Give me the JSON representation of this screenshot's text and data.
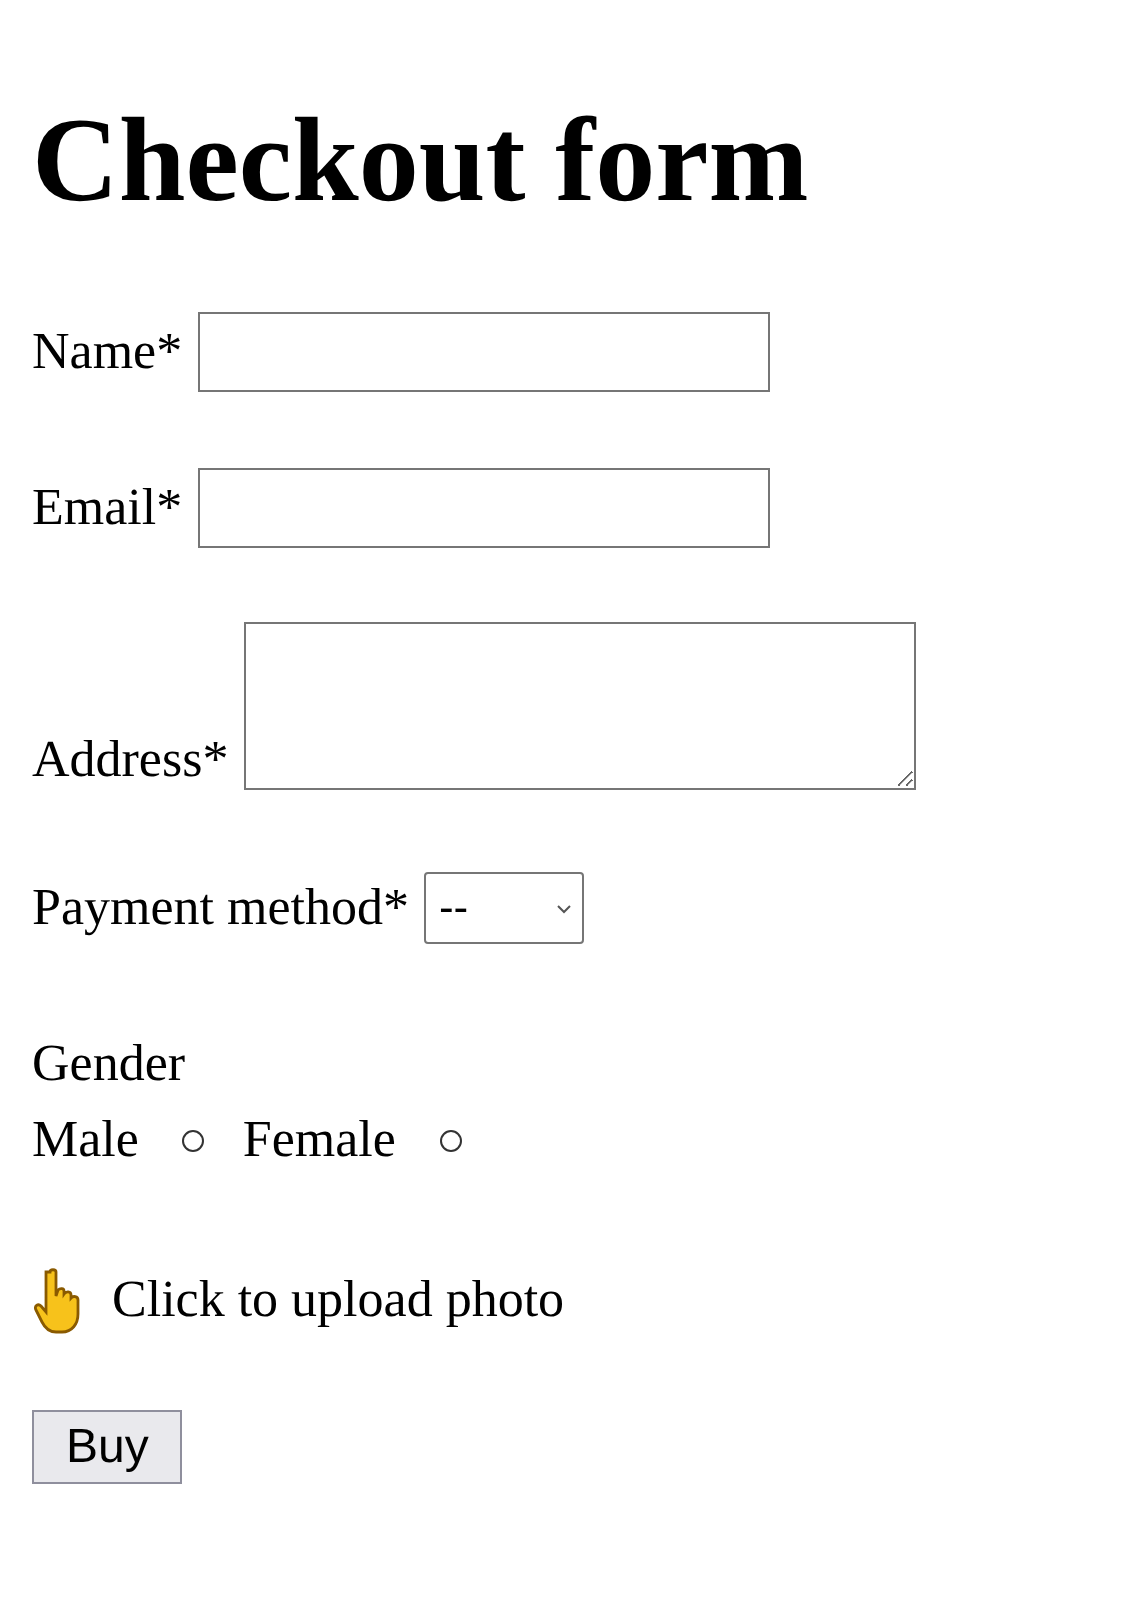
{
  "title": "Checkout form",
  "fields": [
    {
      "label": "Name*",
      "kind": "text"
    },
    {
      "label": "Email*",
      "kind": "text"
    },
    {
      "label": "Address*",
      "kind": "textarea"
    },
    {
      "label": "Payment method*",
      "kind": "select",
      "value": "--"
    }
  ],
  "gender": {
    "label": "Gender",
    "options": [
      {
        "label": "Male",
        "selected": false
      },
      {
        "label": "Female",
        "selected": false
      }
    ]
  },
  "upload": {
    "label": "Click to upload photo"
  },
  "button": "Buy"
}
